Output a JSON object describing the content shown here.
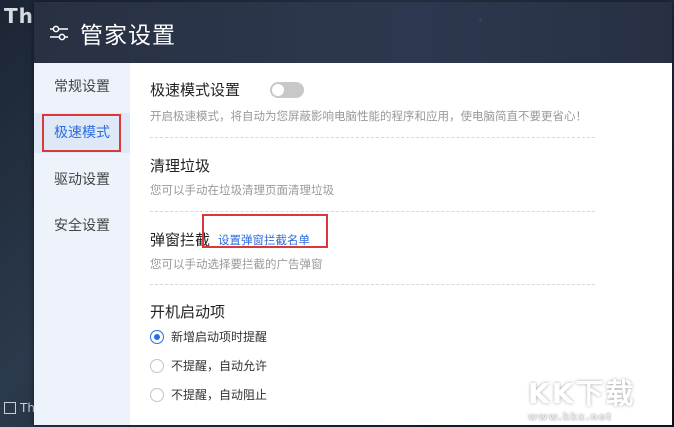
{
  "background": {
    "top_text": "Th",
    "bottom_text": "Thi"
  },
  "window": {
    "title": "管家设置",
    "title_icon": "sliders-icon"
  },
  "sidebar": {
    "items": [
      {
        "label": "常规设置",
        "active": false
      },
      {
        "label": "极速模式",
        "active": true
      },
      {
        "label": "驱动设置",
        "active": false
      },
      {
        "label": "安全设置",
        "active": false
      }
    ]
  },
  "settings": {
    "speed_mode": {
      "title": "极速模式设置",
      "toggle_on": false,
      "desc": "开启极速模式，将自动为您屏蔽影响电脑性能的程序和应用，使电脑简直不要更省心！"
    },
    "cleanup": {
      "title": "清理垃圾",
      "desc": "您可以手动在垃圾清理页面清理垃圾"
    },
    "popup_block": {
      "title": "弹窗拦截",
      "link": "设置弹窗拦截名单",
      "desc": "您可以手动选择要拦截的广告弹窗"
    },
    "startup": {
      "title": "开机启动项",
      "options": [
        {
          "label": "新增启动项时提醒",
          "checked": true
        },
        {
          "label": "不提醒，自动允许",
          "checked": false
        },
        {
          "label": "不提醒，自动阻止",
          "checked": false
        }
      ]
    }
  },
  "colors": {
    "accent": "#2b6de0",
    "highlight": "#d9393b"
  },
  "watermark": {
    "main": "KK下载",
    "url": "www.kkx.net"
  }
}
